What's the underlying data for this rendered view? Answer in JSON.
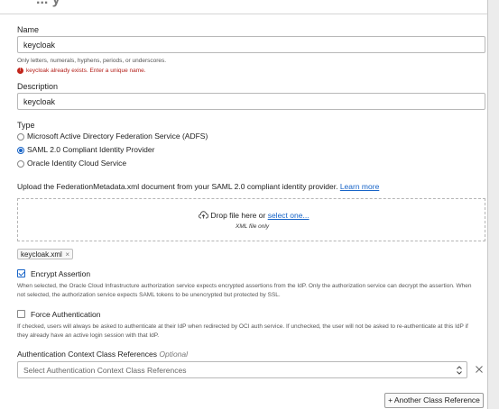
{
  "header": {
    "title_partial": "... y"
  },
  "name_field": {
    "label": "Name",
    "value": "keycloak",
    "hint": "Only letters, numerals, hyphens, periods, or underscores.",
    "error": "keycloak already exists. Enter a unique name."
  },
  "description_field": {
    "label": "Description",
    "value": "keycloak"
  },
  "type_group": {
    "label": "Type",
    "options": [
      {
        "label": "Microsoft Active Directory Federation Service (ADFS)",
        "selected": false
      },
      {
        "label": "SAML 2.0 Compliant Identity Provider",
        "selected": true
      },
      {
        "label": "Oracle Identity Cloud Service",
        "selected": false
      }
    ]
  },
  "upload": {
    "instruction": "Upload the FederationMetadata.xml document from your SAML 2.0 compliant identity provider.",
    "learn_more": "Learn more",
    "drop_text": "Drop file here or",
    "select_link": "select one...",
    "file_type": "XML file only",
    "file_chip": "keycloak.xml"
  },
  "encrypt_assertion": {
    "label": "Encrypt Assertion",
    "checked": true,
    "description": "When selected, the Oracle Cloud Infrastructure authorization service expects encrypted assertions from the IdP. Only the authorization service can decrypt the assertion. When not selected, the authorization service expects SAML tokens to be unencrypted but protected by SSL."
  },
  "force_auth": {
    "label": "Force Authentication",
    "checked": false,
    "description": "If checked, users will always be asked to authenticate at their IdP when redirected by OCI auth service. If unchecked, the user will not be asked to re-authenticate at this IdP if they already have an active login session with that IdP."
  },
  "auth_context": {
    "label": "Authentication Context Class References",
    "optional": "Optional",
    "placeholder": "Select Authentication Context Class References",
    "add_button": "+ Another Class Reference"
  },
  "colors": {
    "accent": "#1663c7",
    "error": "#c2261c"
  }
}
